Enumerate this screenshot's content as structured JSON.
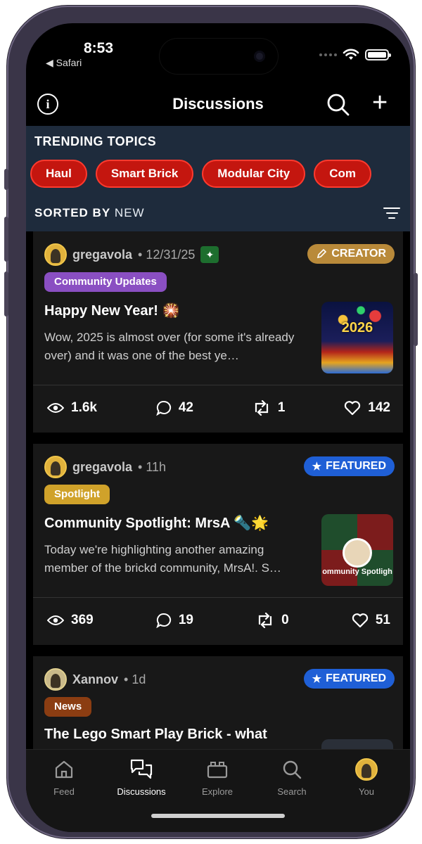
{
  "status": {
    "time": "8:53",
    "back_label": "◀ Safari"
  },
  "header": {
    "title": "Discussions"
  },
  "trending": {
    "title": "TRENDING TOPICS",
    "chips": [
      "Haul",
      "Smart Brick",
      "Modular City",
      "Com"
    ]
  },
  "sort": {
    "label": "SORTED BY",
    "value": "NEW"
  },
  "posts": [
    {
      "author": "gregavola",
      "meta": "• 12/31/25",
      "badge": "CREATOR",
      "tag": "Community Updates",
      "tag_color": "#8a4fc2",
      "title": "Happy New Year! 🎇",
      "excerpt": "Wow, 2025 is almost over (for some it's already over) and it was one of the best ye…",
      "thumb_text": "2026",
      "views": "1.6k",
      "comments": "42",
      "reposts": "1",
      "likes": "142"
    },
    {
      "author": "gregavola",
      "meta": "• 11h",
      "badge": "FEATURED",
      "tag": "Spotlight",
      "tag_color": "#d0a22a",
      "title": "Community Spotlight: MrsA 🔦🌟",
      "excerpt": "Today we're highlighting another amazing member of the brickd community, MrsA!. S…",
      "thumb_text": "ommunity Spotligh",
      "views": "369",
      "comments": "19",
      "reposts": "0",
      "likes": "51"
    },
    {
      "author": "Xannov",
      "meta": "• 1d",
      "badge": "FEATURED",
      "tag": "News",
      "tag_color": "#8b3d12",
      "title": "The Lego Smart Play Brick - what"
    }
  ],
  "tabs": [
    "Feed",
    "Discussions",
    "Explore",
    "Search",
    "You"
  ],
  "colors": {
    "chip": "#c4160f",
    "trending_bg": "#1e2b3c",
    "featured": "#1f5fd6",
    "creator": "#b98a3a"
  }
}
